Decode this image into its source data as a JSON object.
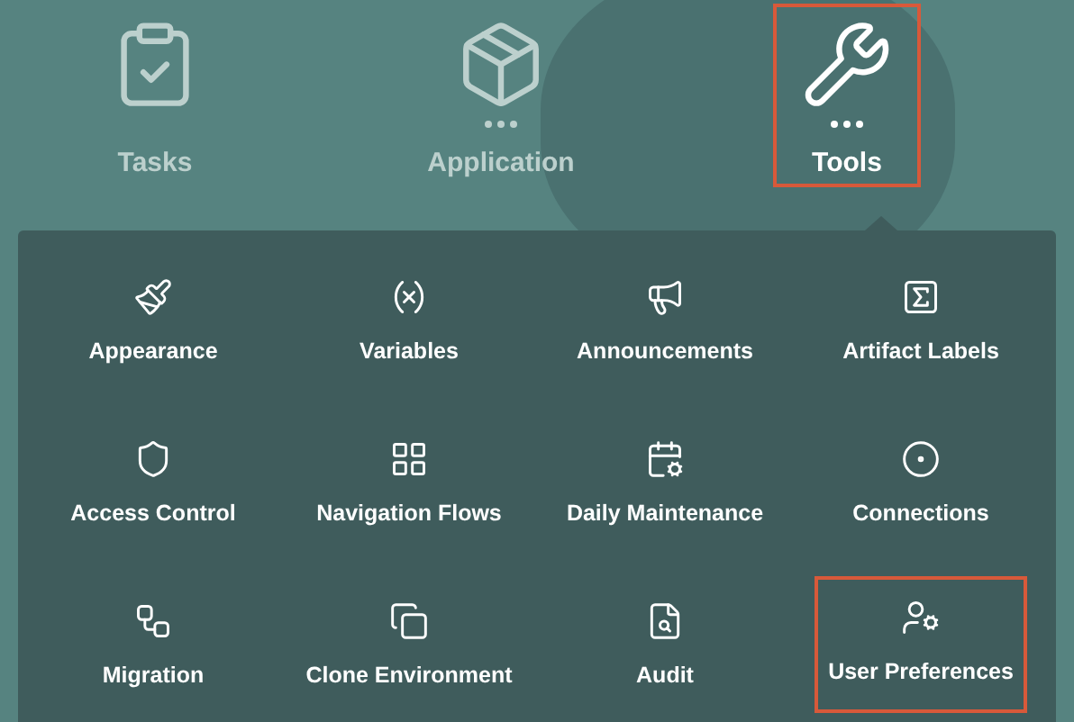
{
  "nav": [
    {
      "label": "Tasks",
      "selected": false,
      "has_more": false,
      "highlighted": false
    },
    {
      "label": "Application",
      "selected": false,
      "has_more": true,
      "highlighted": false
    },
    {
      "label": "Tools",
      "selected": true,
      "has_more": true,
      "highlighted": true
    }
  ],
  "tools_menu": {
    "items": [
      {
        "label": "Appearance",
        "highlighted": false
      },
      {
        "label": "Variables",
        "highlighted": false
      },
      {
        "label": "Announcements",
        "highlighted": false
      },
      {
        "label": "Artifact Labels",
        "highlighted": false
      },
      {
        "label": "Access Control",
        "highlighted": false
      },
      {
        "label": "Navigation Flows",
        "highlighted": false
      },
      {
        "label": "Daily Maintenance",
        "highlighted": false
      },
      {
        "label": "Connections",
        "highlighted": false
      },
      {
        "label": "Migration",
        "highlighted": false
      },
      {
        "label": "Clone Environment",
        "highlighted": false
      },
      {
        "label": "Audit",
        "highlighted": false
      },
      {
        "label": "User Preferences",
        "highlighted": true
      }
    ]
  }
}
